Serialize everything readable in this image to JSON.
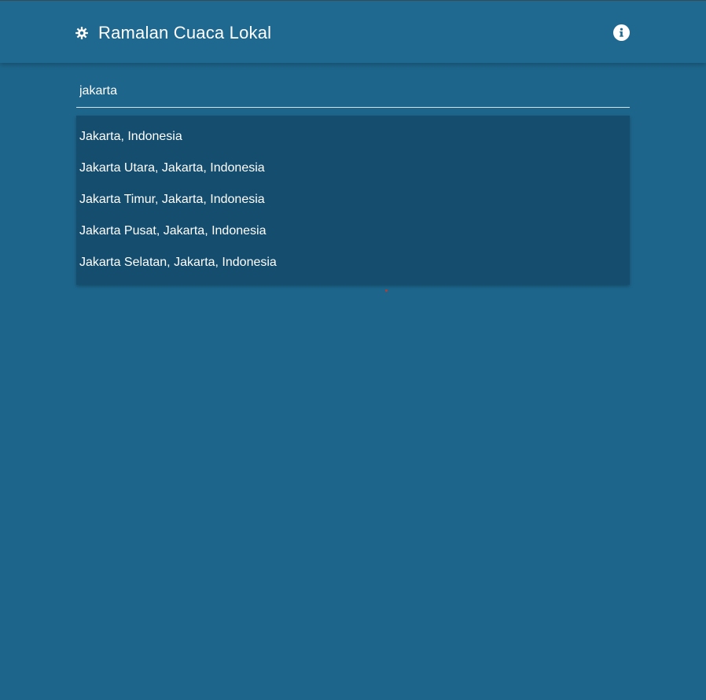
{
  "app": {
    "title": "Ramalan Cuaca Lokal",
    "logo_icon": "gear-icon",
    "info_icon": "info-icon"
  },
  "search": {
    "value": "jakarta"
  },
  "suggestions": [
    "Jakarta, Indonesia",
    "Jakarta Utara, Jakarta, Indonesia",
    "Jakarta Timur, Jakarta, Indonesia",
    "Jakarta Pusat, Jakarta, Indonesia",
    "Jakarta Selatan, Jakarta, Indonesia"
  ],
  "colors": {
    "background": "#1d658b",
    "appbar": "#1f6890",
    "dropdown": "#144d6e",
    "text": "#ffffff"
  }
}
